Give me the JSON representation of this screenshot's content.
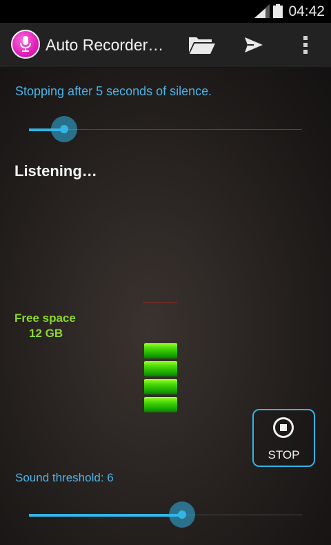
{
  "status_bar": {
    "time": "04:42"
  },
  "action_bar": {
    "title": "Auto Recorder…",
    "icons": [
      "microphone-icon",
      "folder-icon",
      "send-icon",
      "overflow-menu-icon"
    ]
  },
  "silence": {
    "text": "Stopping after 5 seconds of silence.",
    "slider_value_fraction": 0.13
  },
  "status_text": "Listening…",
  "free_space": {
    "label": "Free space",
    "value": "12 GB"
  },
  "level_meter": {
    "segments_lit": 4
  },
  "stop_button": {
    "label": "STOP"
  },
  "threshold": {
    "text": "Sound threshold: 6",
    "slider_value_fraction": 0.56
  },
  "colors": {
    "accent": "#33b5e5",
    "free_space_green": "#8bd92a",
    "app_icon_pink": "#e01fb7",
    "meter_green": "#4fdc0a",
    "marker_red": "#b3261e"
  }
}
